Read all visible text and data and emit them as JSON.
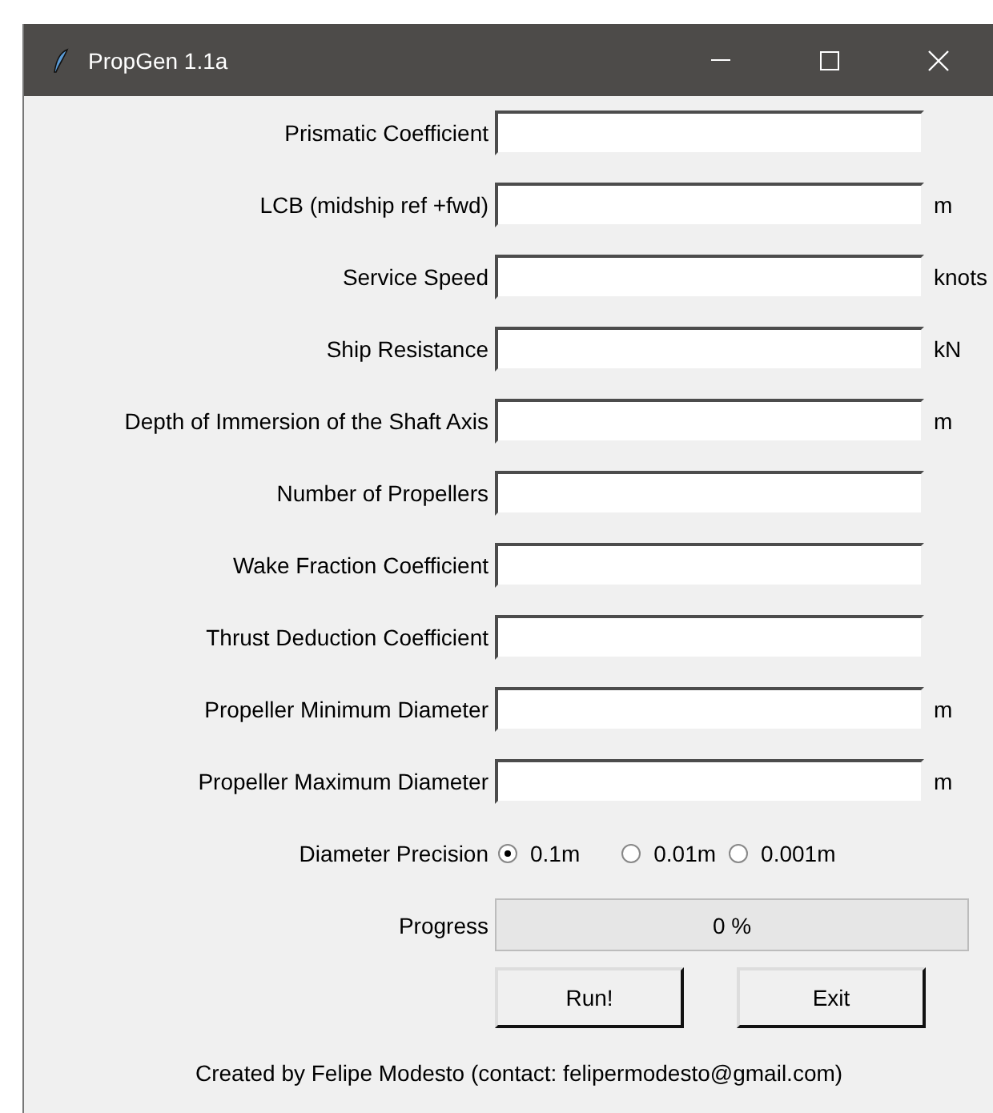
{
  "window": {
    "title": "PropGen 1.1a"
  },
  "fields": [
    {
      "label": "Prismatic Coefficient"
    },
    {
      "label": "LCB (midship ref +fwd)",
      "unit": "m"
    },
    {
      "label": "Service Speed",
      "unit": "knots"
    },
    {
      "label": "Ship Resistance",
      "unit": "kN"
    },
    {
      "label": "Depth of Immersion of the Shaft Axis",
      "unit": "m"
    },
    {
      "label": "Number of Propellers"
    },
    {
      "label": "Wake Fraction Coefficient"
    },
    {
      "label": "Thrust Deduction Coefficient"
    },
    {
      "label": "Propeller Minimum Diameter",
      "unit": "m"
    },
    {
      "label": "Propeller Maximum Diameter",
      "unit": "m"
    }
  ],
  "precision": {
    "label": "Diameter Precision",
    "options": [
      {
        "label": "0.1m",
        "selected": true
      },
      {
        "label": "0.01m",
        "selected": false
      },
      {
        "label": "0.001m",
        "selected": false
      }
    ]
  },
  "progress": {
    "label": "Progress",
    "level": 0,
    "reading": "0 %"
  },
  "buttons": [
    "Run!",
    "Exit"
  ],
  "footer": "Created by Felipe Modesto (contact: felipermodesto@gmail.com)"
}
